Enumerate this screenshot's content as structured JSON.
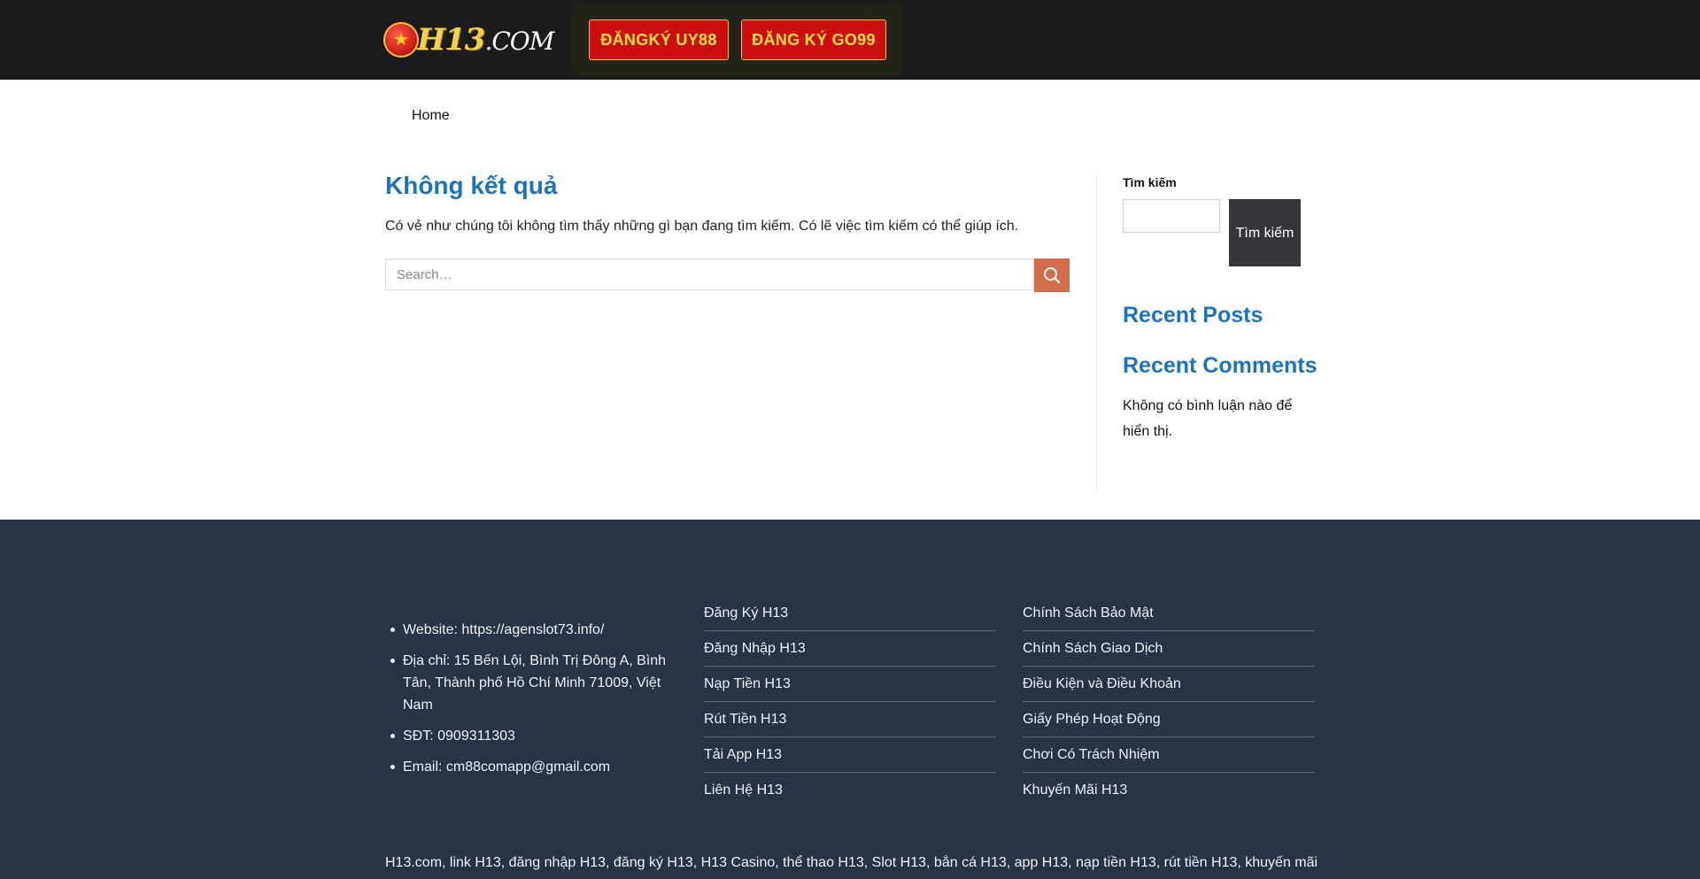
{
  "header": {
    "logo_text": "H13",
    "logo_suffix": ".COM",
    "register_uy88": "ĐĂNGKÝ UY88",
    "register_go99": "ĐĂNG KÝ GO99"
  },
  "nav": {
    "home": "Home"
  },
  "main": {
    "title": "Không kết quả",
    "message": "Có vẻ như chúng tôi không tìm thấy những gì bạn đang tìm kiếm. Có lẽ việc tìm kiếm có thể giúp ích.",
    "search_placeholder": "Search…"
  },
  "sidebar": {
    "search_label": "Tìm kiếm",
    "search_button": "Tìm kiếm",
    "recent_posts": "Recent Posts",
    "recent_comments": "Recent Comments",
    "no_comments": "Không có bình luận nào để hiển thị."
  },
  "footer": {
    "contact": [
      "Website: https://agenslot73.info/",
      "Địa chỉ: 15 Bến Lội, Bình Trị Đông A, Bình Tân, Thành phố Hồ Chí Minh 71009, Việt Nam",
      "SĐT: 0909311303",
      "Email: cm88comapp@gmail.com"
    ],
    "links_col1": [
      "Đăng Ký H13",
      "Đăng Nhập H13",
      "Nạp Tiền H13",
      "Rút Tiền H13",
      "Tải App H13",
      "Liên Hệ H13"
    ],
    "links_col2": [
      "Chính Sách Bảo Mật",
      "Chính Sách Giao Dịch",
      "Điều Kiện và Điều Khoản",
      "Giấy Phép Hoạt Động",
      "Chơi Có Trách Nhiệm",
      "Khuyến Mãi H13"
    ],
    "bottom_text": "H13.com, link H13, đăng nhập H13, đăng ký H13, H13 Casino, thể thao H13, Slot H13, bắn cá H13, app H13, nạp tiền H13, rút tiền H13, khuyến mãi"
  },
  "colors": {
    "header_bg": "#1c1c1c",
    "accent_blue": "#1e73be",
    "register_red": "#cc0e0e",
    "register_text": "#ffe13a",
    "search_orange": "#d26e4b",
    "footer_bg": "#263445"
  }
}
